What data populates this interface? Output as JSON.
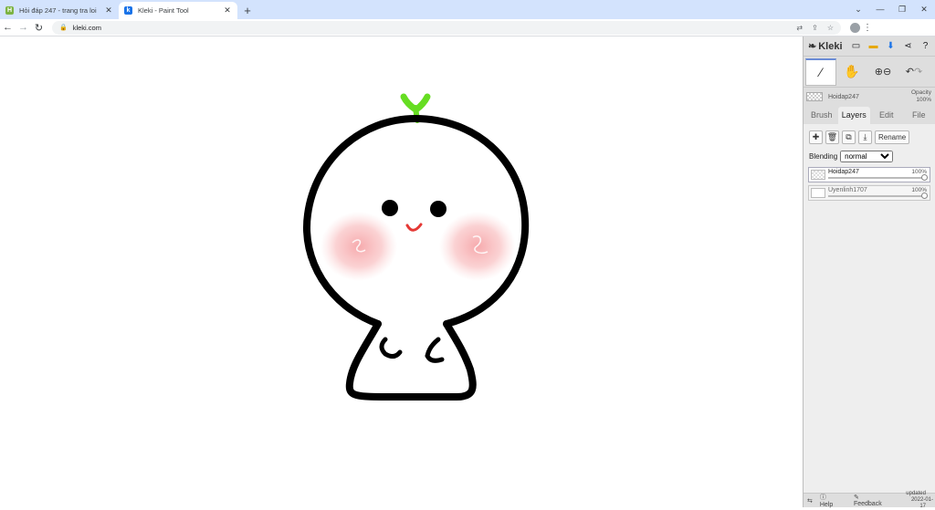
{
  "browser": {
    "tabs": [
      {
        "title": "Hỏi đáp 247 - trang tra loi",
        "favicon": "247-icon",
        "favicon_color": "#7cb342"
      },
      {
        "title": "Kleki - Paint Tool",
        "favicon": "kleki-icon",
        "favicon_color": "#1a73e8"
      }
    ],
    "url": "kleki.com"
  },
  "panel": {
    "logo": "Kleki",
    "brush_layer_name": "Hoidap247",
    "opacity_label": "Opacity",
    "opacity_value": "100%",
    "tabs": [
      "Brush",
      "Layers",
      "Edit",
      "File"
    ],
    "selected_tab": "Layers",
    "rename_label": "Rename",
    "blending_label": "Blending",
    "blending_value": "normal",
    "layers": [
      {
        "name": "Hoidap247",
        "opacity": "100%",
        "opacity_fraction": 1.0
      },
      {
        "name": "Uyenlinh1707",
        "opacity": "100%",
        "opacity_fraction": 1.0
      }
    ],
    "footer": {
      "help": "Help",
      "feedback": "Feedback",
      "updated": "updated",
      "updated_date": "2022-01-17"
    }
  },
  "colors": {
    "accent": "#d3e3fd",
    "panel": "#dedede",
    "sprout": "#66dd22",
    "blush": "#f6a5a8",
    "mouth": "#e53935"
  }
}
